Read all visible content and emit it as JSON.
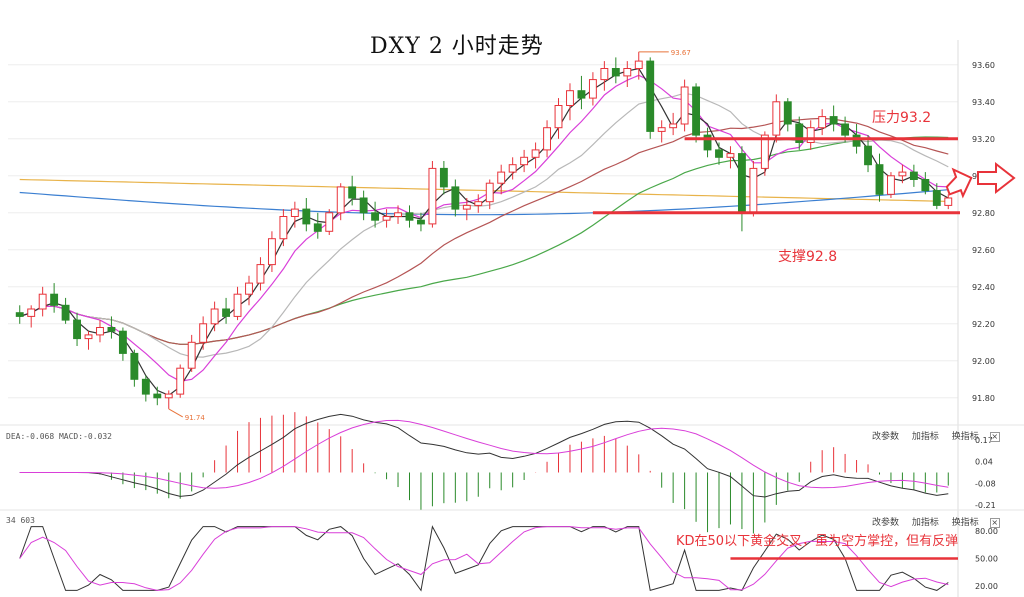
{
  "title": "DXY 2 小时走势",
  "annotations": {
    "resistance": "压力93.2",
    "support": "支撑92.8",
    "kd_note": "KD在50以下黄金交叉，虽为空方掌控，但有反弹",
    "high_price": "93.67",
    "low_price": "91.74"
  },
  "macd_label": "DEA:-0.068  MACD:-0.032",
  "kd_label": "34 603",
  "toolbar": {
    "params": "改参数",
    "add": "加指标",
    "switch": "换指标",
    "close": "×"
  },
  "colors": {
    "up": "#e8333a",
    "down": "#2a8a2a",
    "ma_short": "#d93fd9",
    "ma_mid": "#333333",
    "ma_gray": "#b8b8b8",
    "ma_brown": "#b55555",
    "ma_green": "#4aa84a",
    "ma_blue": "#3b7fd1",
    "ma_orange": "#e8b34a",
    "level": "#e8333a"
  },
  "chart_data": [
    {
      "type": "candlestick",
      "title": "DXY 2 小时走势",
      "ylim": [
        91.68,
        93.68
      ],
      "yticks": [
        "93.60",
        "93.40",
        "93.20",
        "93.00",
        "92.80",
        "92.60",
        "92.40",
        "92.20",
        "92.00",
        "91.80"
      ],
      "levels": [
        {
          "name": "压力93.2",
          "value": 93.2
        },
        {
          "name": "支撑92.8",
          "value": 92.8
        }
      ],
      "ohlc": [
        [
          92.26,
          92.3,
          92.2,
          92.24
        ],
        [
          92.24,
          92.3,
          92.18,
          92.28
        ],
        [
          92.28,
          92.4,
          92.24,
          92.36
        ],
        [
          92.36,
          92.42,
          92.26,
          92.3
        ],
        [
          92.3,
          92.34,
          92.2,
          92.22
        ],
        [
          92.22,
          92.26,
          92.08,
          92.12
        ],
        [
          92.12,
          92.16,
          92.06,
          92.14
        ],
        [
          92.14,
          92.22,
          92.1,
          92.18
        ],
        [
          92.18,
          92.24,
          92.12,
          92.16
        ],
        [
          92.16,
          92.18,
          92.0,
          92.04
        ],
        [
          92.04,
          92.06,
          91.86,
          91.9
        ],
        [
          91.9,
          91.92,
          91.78,
          91.82
        ],
        [
          91.82,
          91.86,
          91.76,
          91.8
        ],
        [
          91.8,
          91.84,
          91.74,
          91.82
        ],
        [
          91.82,
          91.98,
          91.8,
          91.96
        ],
        [
          91.96,
          92.14,
          91.94,
          92.1
        ],
        [
          92.1,
          92.24,
          92.06,
          92.2
        ],
        [
          92.2,
          92.32,
          92.16,
          92.28
        ],
        [
          92.28,
          92.34,
          92.2,
          92.24
        ],
        [
          92.24,
          92.4,
          92.22,
          92.36
        ],
        [
          92.36,
          92.46,
          92.3,
          92.42
        ],
        [
          92.42,
          92.56,
          92.38,
          92.52
        ],
        [
          92.52,
          92.7,
          92.48,
          92.66
        ],
        [
          92.66,
          92.82,
          92.62,
          92.78
        ],
        [
          92.78,
          92.86,
          92.72,
          92.82
        ],
        [
          92.82,
          92.88,
          92.7,
          92.74
        ],
        [
          92.74,
          92.8,
          92.66,
          92.7
        ],
        [
          92.7,
          92.82,
          92.68,
          92.8
        ],
        [
          92.8,
          92.96,
          92.76,
          92.94
        ],
        [
          92.94,
          93.0,
          92.84,
          92.88
        ],
        [
          92.88,
          92.92,
          92.76,
          92.8
        ],
        [
          92.8,
          92.86,
          92.72,
          92.76
        ],
        [
          92.76,
          92.82,
          92.72,
          92.78
        ],
        [
          92.78,
          92.84,
          92.74,
          92.8
        ],
        [
          92.8,
          92.84,
          92.72,
          92.76
        ],
        [
          92.76,
          92.8,
          92.7,
          92.74
        ],
        [
          92.74,
          93.08,
          92.72,
          93.04
        ],
        [
          93.04,
          93.08,
          92.9,
          92.94
        ],
        [
          92.94,
          92.98,
          92.78,
          92.82
        ],
        [
          92.82,
          92.88,
          92.76,
          92.84
        ],
        [
          92.84,
          92.9,
          92.8,
          92.86
        ],
        [
          92.86,
          92.98,
          92.82,
          92.96
        ],
        [
          92.96,
          93.06,
          92.9,
          93.02
        ],
        [
          93.02,
          93.1,
          92.98,
          93.06
        ],
        [
          93.06,
          93.14,
          93.02,
          93.1
        ],
        [
          93.1,
          93.18,
          93.04,
          93.14
        ],
        [
          93.14,
          93.3,
          93.1,
          93.26
        ],
        [
          93.26,
          93.42,
          93.2,
          93.38
        ],
        [
          93.38,
          93.5,
          93.3,
          93.46
        ],
        [
          93.46,
          93.54,
          93.36,
          93.42
        ],
        [
          93.42,
          93.56,
          93.38,
          93.52
        ],
        [
          93.52,
          93.62,
          93.46,
          93.58
        ],
        [
          93.58,
          93.64,
          93.5,
          93.54
        ],
        [
          93.54,
          93.62,
          93.48,
          93.58
        ],
        [
          93.58,
          93.67,
          93.52,
          93.62
        ],
        [
          93.62,
          93.64,
          93.2,
          93.24
        ],
        [
          93.24,
          93.3,
          93.18,
          93.26
        ],
        [
          93.26,
          93.34,
          93.22,
          93.28
        ],
        [
          93.28,
          93.52,
          93.24,
          93.48
        ],
        [
          93.48,
          93.5,
          93.18,
          93.22
        ],
        [
          93.22,
          93.26,
          93.1,
          93.14
        ],
        [
          93.14,
          93.18,
          93.06,
          93.1
        ],
        [
          93.1,
          93.16,
          93.04,
          93.12
        ],
        [
          93.12,
          93.16,
          92.7,
          92.8
        ],
        [
          92.8,
          93.08,
          92.78,
          93.04
        ],
        [
          93.04,
          93.24,
          93.0,
          93.22
        ],
        [
          93.22,
          93.44,
          93.18,
          93.4
        ],
        [
          93.4,
          93.42,
          93.24,
          93.28
        ],
        [
          93.28,
          93.32,
          93.14,
          93.18
        ],
        [
          93.18,
          93.3,
          93.14,
          93.26
        ],
        [
          93.26,
          93.36,
          93.22,
          93.32
        ],
        [
          93.32,
          93.38,
          93.24,
          93.28
        ],
        [
          93.28,
          93.32,
          93.18,
          93.22
        ],
        [
          93.22,
          93.28,
          93.12,
          93.16
        ],
        [
          93.16,
          93.22,
          93.02,
          93.06
        ],
        [
          93.06,
          93.12,
          92.86,
          92.9
        ],
        [
          92.9,
          93.02,
          92.88,
          93.0
        ],
        [
          93.0,
          93.06,
          92.96,
          93.02
        ],
        [
          93.02,
          93.06,
          92.94,
          92.98
        ],
        [
          92.98,
          93.02,
          92.9,
          92.92
        ],
        [
          92.92,
          92.96,
          92.82,
          92.84
        ],
        [
          92.84,
          92.9,
          92.82,
          92.88
        ]
      ]
    },
    {
      "type": "line",
      "title": "MACD",
      "values": {
        "DEA": -0.068,
        "MACD": -0.032
      },
      "yticks": [
        "0.17",
        "0.04",
        "-0.08",
        "-0.21"
      ]
    },
    {
      "type": "line",
      "title": "KD",
      "yticks": [
        "80.00",
        "50.00",
        "20.00"
      ],
      "level": 50
    }
  ]
}
